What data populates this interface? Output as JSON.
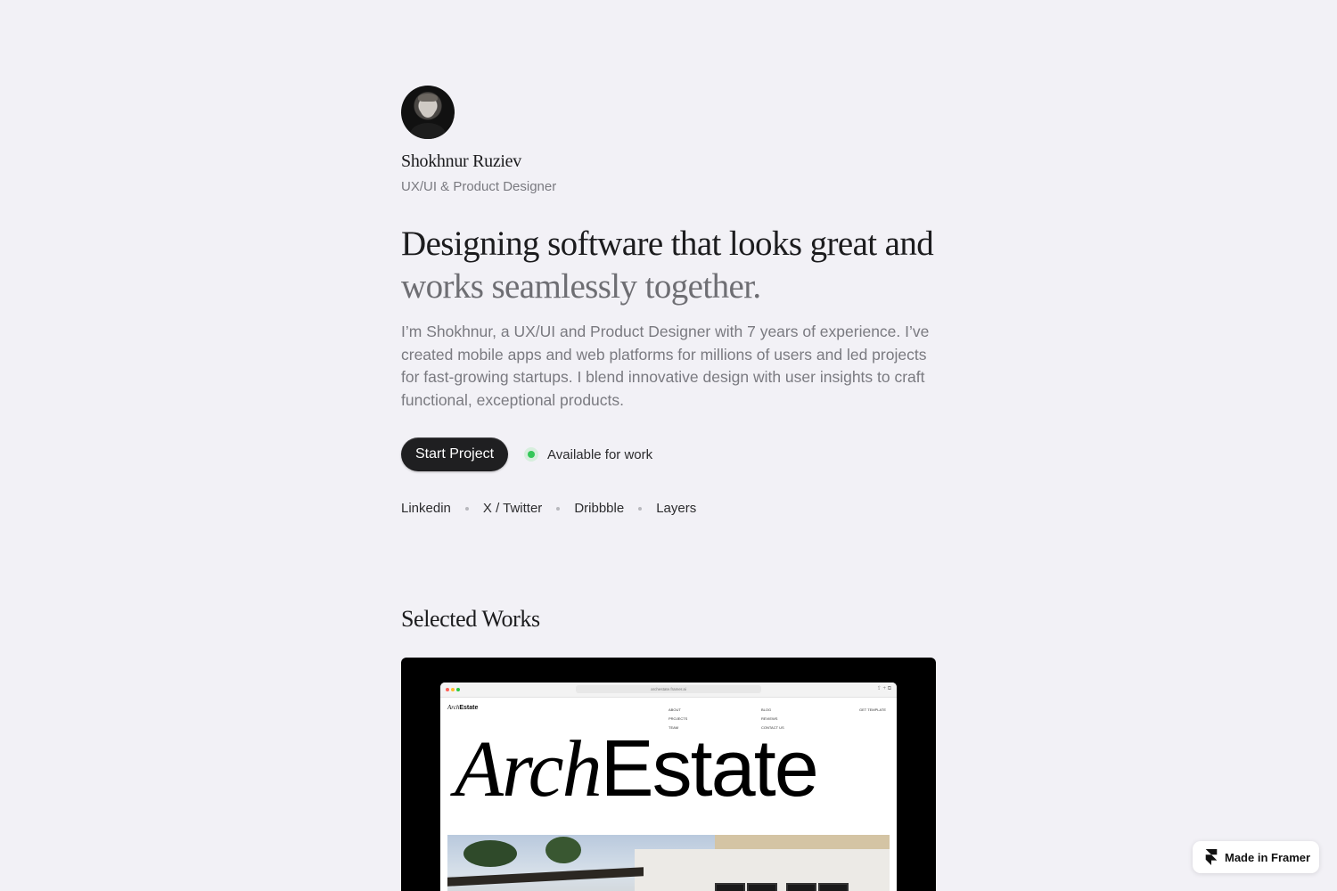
{
  "profile": {
    "name": "Shokhnur Ruziev",
    "role": "UX/UI & Product Designer"
  },
  "hero": {
    "headline_dark": "Designing software that looks great and",
    "headline_muted": "works seamlessly together.",
    "bio": "I’m Shokhnur, a UX/UI and Product Designer with 7 years of experience. I’ve created mobile apps and web platforms for millions of users and led projects for fast-growing startups. I blend innovative design with user insights to craft functional, exceptional products."
  },
  "cta": {
    "button_label": "Start Project",
    "status_label": "Available for work",
    "status_color": "#34c759"
  },
  "social_links": [
    "Linkedin",
    "X / Twitter",
    "Dribbble",
    "Layers"
  ],
  "works": {
    "section_title": "Selected Works",
    "card": {
      "url": "archestate.framer.ai",
      "logo_italic": "Arch",
      "logo_regular": "Estate",
      "nav_col1": [
        "ABOUT",
        "PROJECTS",
        "TEAM"
      ],
      "nav_col2": [
        "BLOG",
        "REVIEWS",
        "CONTACT US"
      ],
      "nav_cta": "GET TEMPLATE",
      "hero_italic": "Arch",
      "hero_regular": "Estate"
    }
  },
  "badge": {
    "label": "Made in Framer"
  }
}
